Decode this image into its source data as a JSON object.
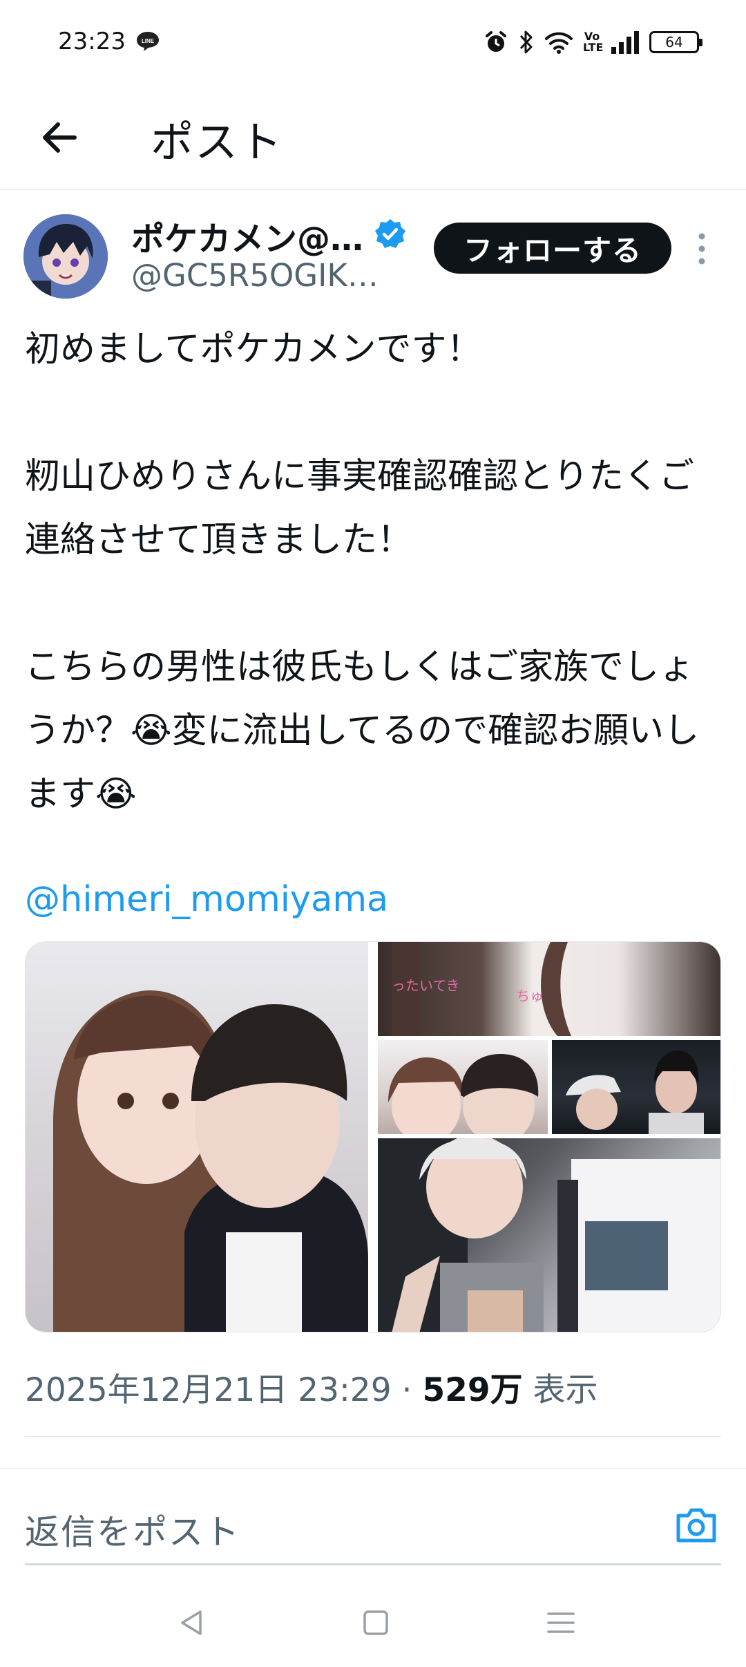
{
  "status_bar": {
    "time": "23:23",
    "notification_icon": "line-app-icon",
    "icons": [
      "alarm-icon",
      "bluetooth-icon",
      "wifi-icon",
      "volte-icon",
      "signal-icon"
    ],
    "volte_label": "Vo LTE",
    "battery": "64"
  },
  "header": {
    "title": "ポスト",
    "back_icon": "back-arrow-icon"
  },
  "author": {
    "display_name": "ポケカメン@…",
    "handle": "@GC5R5OGIK…",
    "verified": true,
    "follow_label": "フォローする",
    "colors": {
      "verified": "#1d9bf0",
      "follow_bg": "#0f1419"
    }
  },
  "tweet": {
    "line1": "初めましてポケカメンです！",
    "para2": "籾山ひめりさんに事実確認確認とりたくご連絡させて頂きました！",
    "para3": "こちらの男性は彼氏もしくはご家族でしょうか？😭変に流出してるので確認お願いします😭",
    "mention": "@himeri_momiyama",
    "media_count": 5
  },
  "meta": {
    "date": "2025年12月21日 23:29",
    "separator": " · ",
    "views_count": "529万",
    "views_label": " 表示"
  },
  "reply": {
    "placeholder": "返信をポスト",
    "icon": "camera-icon",
    "accent": "#1d9bf0"
  },
  "nav": {
    "icons": [
      "nav-back-icon",
      "nav-home-icon",
      "nav-menu-icon"
    ]
  }
}
